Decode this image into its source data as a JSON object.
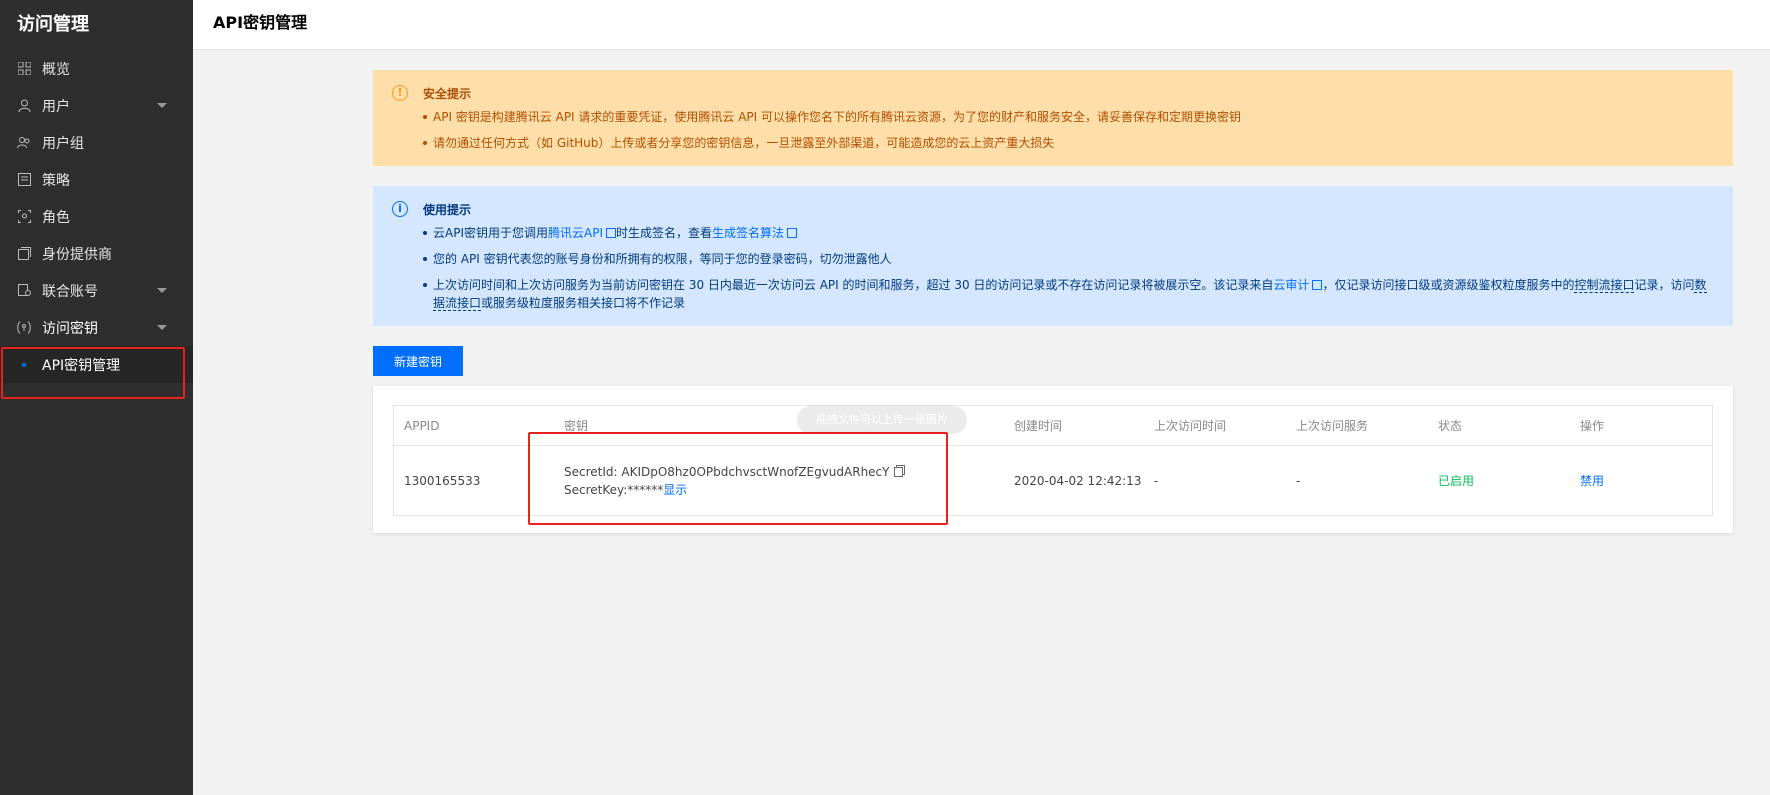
{
  "sidebar": {
    "title": "访问管理",
    "items": [
      {
        "label": "概览",
        "icon": "grid-icon"
      },
      {
        "label": "用户",
        "icon": "user-icon"
      },
      {
        "label": "用户组",
        "icon": "user-group-icon"
      },
      {
        "label": "策略",
        "icon": "policy-icon"
      },
      {
        "label": "角色",
        "icon": "role-icon"
      },
      {
        "label": "身份提供商",
        "icon": "identity-provider-icon"
      },
      {
        "label": "联合账号",
        "icon": "federated-account-icon"
      },
      {
        "label": "访问密钥",
        "icon": "access-key-icon"
      }
    ],
    "submenu": {
      "label": "API密钥管理"
    }
  },
  "header": {
    "title": "API密钥管理"
  },
  "warning": {
    "title": "安全提示",
    "items": [
      "API 密钥是构建腾讯云 API 请求的重要凭证，使用腾讯云 API 可以操作您名下的所有腾讯云资源，为了您的财产和服务安全，请妥善保存和定期更换密钥",
      "请勿通过任何方式（如 GitHub）上传或者分享您的密钥信息，一旦泄露至外部渠道，可能造成您的云上资产重大损失"
    ]
  },
  "info": {
    "title": "使用提示",
    "item1": {
      "pre": "云API密钥用于您调用",
      "link1": "腾讯云API",
      "mid": "时生成签名，查看",
      "link2": "生成签名算法"
    },
    "item2": "您的 API 密钥代表您的账号身份和所拥有的权限，等同于您的登录密码，切勿泄露他人",
    "item3": {
      "pre": "上次访问时间和上次访问服务为当前访问密钥在 30 日内最近一次访问云 API 的时间和服务，超过 30 日的访问记录或不存在访问记录将被展示空。该记录来自",
      "link": "云审计",
      "mid": "，仅记录访问接口级或资源级鉴权粒度服务中的",
      "dash1": "控制流接口",
      "mid2": "记录，访问",
      "dash2": "数据流接口",
      "post": "或服务级粒度服务相关接口将不作记录"
    }
  },
  "new_button": "新建密钥",
  "table": {
    "headers": [
      "APPID",
      "密钥",
      "创建时间",
      "上次访问时间",
      "上次访问服务",
      "状态",
      "操作"
    ],
    "row": {
      "appid": "1300165533",
      "secret_id": "SecretId: AKIDpO8hz0OPbdchvsctWnofZEgvudARhecY",
      "secret_key_label": "SecretKey:******",
      "show_label": "显示",
      "created": "2020-04-02 12:42:13",
      "last_time": "-",
      "last_service": "-",
      "status": "已启用",
      "action": "禁用"
    }
  },
  "tooltip": "拖拽文件可以上传一张图片"
}
